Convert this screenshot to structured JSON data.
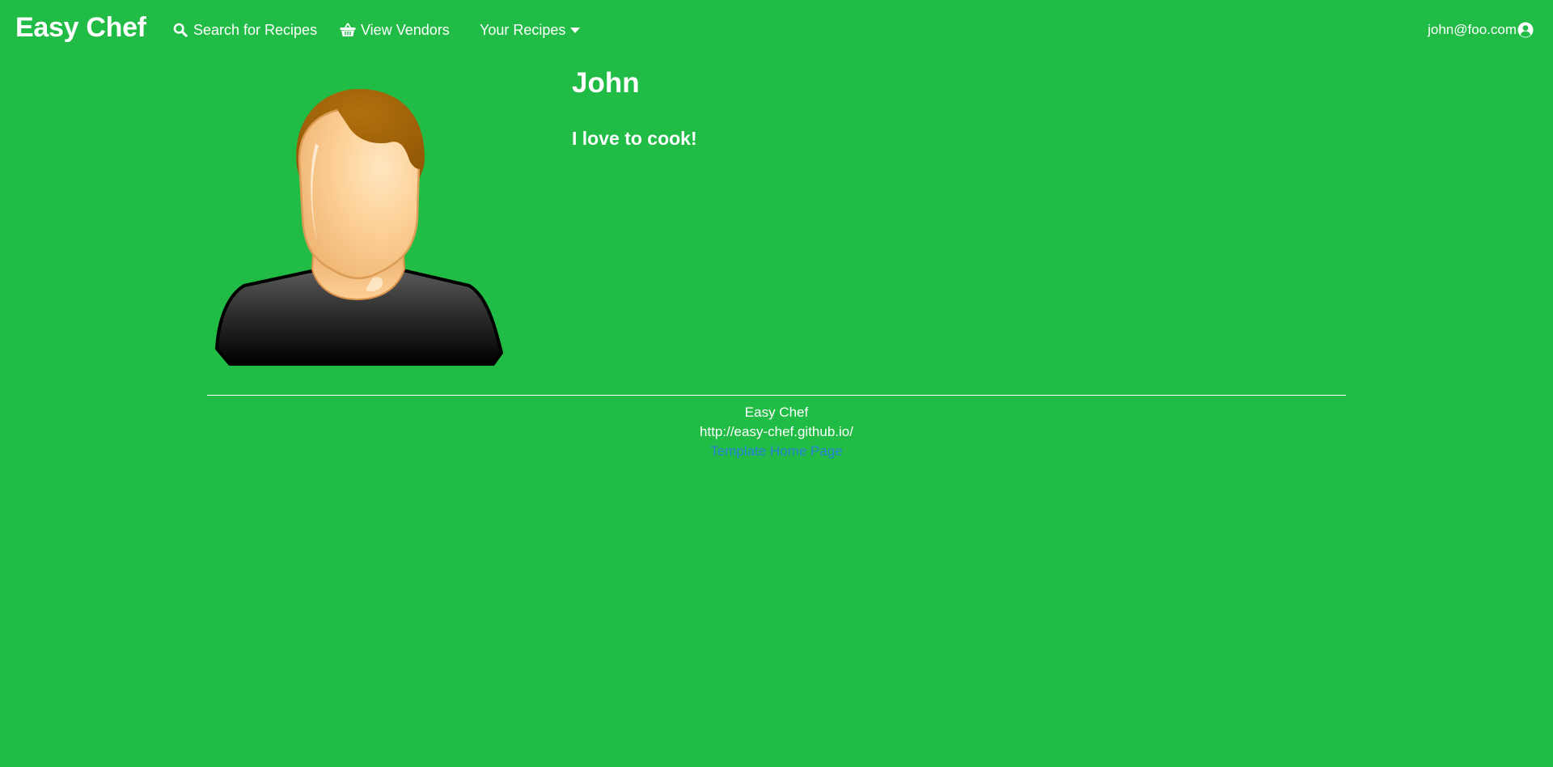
{
  "navbar": {
    "brand": "Easy Chef",
    "items": [
      {
        "label": "Search for Recipes",
        "icon": "search-icon"
      },
      {
        "label": "View Vendors",
        "icon": "basket-icon"
      },
      {
        "label": "Your Recipes",
        "icon": "caret-down-icon"
      }
    ],
    "user": {
      "email": "john@foo.com",
      "icon": "user-circle-icon"
    }
  },
  "profile": {
    "name": "John",
    "bio": "I love to cook!"
  },
  "footer": {
    "site_name": "Easy Chef",
    "site_url": "http://easy-chef.github.io/",
    "link_label": "Template Home Page"
  },
  "colors": {
    "background": "#21bc46",
    "text": "#ffffff",
    "link": "#2b7fd8"
  }
}
